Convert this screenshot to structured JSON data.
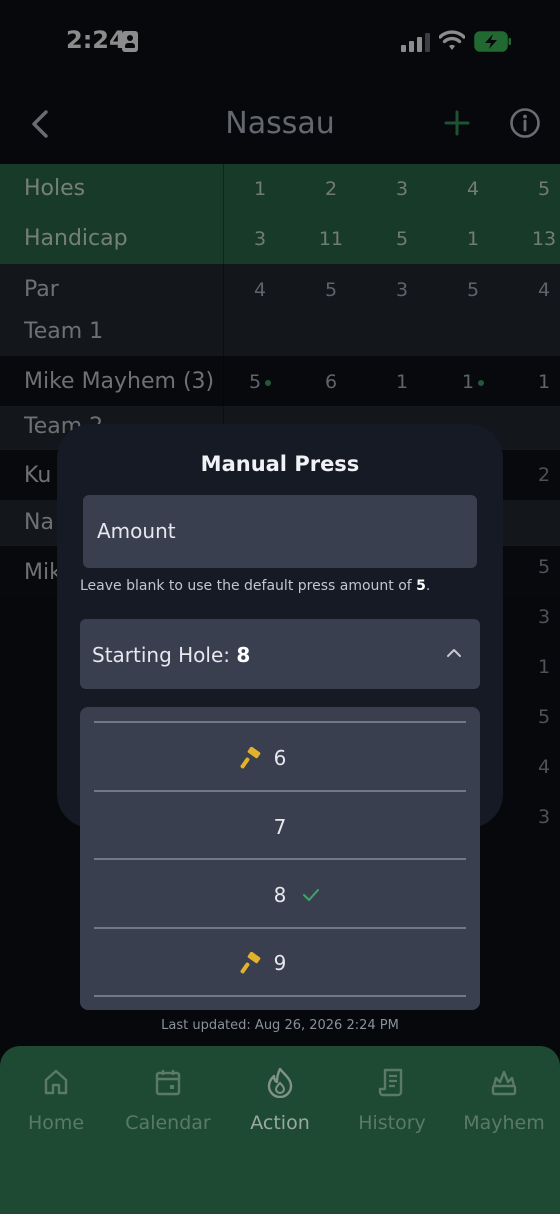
{
  "status_bar": {
    "time": "2:24"
  },
  "nav": {
    "title": "Nassau"
  },
  "table": {
    "holes_label": "Holes",
    "holes": [
      "1",
      "2",
      "3",
      "4",
      "5"
    ],
    "handicap_label": "Handicap",
    "handicap": [
      "3",
      "11",
      "5",
      "1",
      "13"
    ],
    "par_label": "Par",
    "par": [
      "4",
      "5",
      "3",
      "5",
      "4"
    ],
    "team1_label": "Team 1",
    "player1_name": "Mike Mayhem (3)",
    "player1_scores": [
      "5",
      "6",
      "1",
      "1",
      "1"
    ],
    "team2_label": "Team 2",
    "partial_row3_label": "Ku",
    "partial_row4_label": "Na",
    "partial_row5_label": "Mik",
    "right_column": [
      "2",
      "5",
      "3",
      "1",
      "5",
      "4",
      "3"
    ]
  },
  "manual_press": {
    "title": "Manual Press",
    "amount_placeholder": "Amount",
    "hint_prefix": "Leave blank to use the default press amount of ",
    "hint_amount": "5",
    "hint_suffix": ".",
    "starting_hole_label": "Starting Hole: ",
    "starting_hole_value": "8",
    "options": [
      "6",
      "7",
      "8",
      "9"
    ]
  },
  "last_updated": "Last updated: Aug 26, 2026 2:24 PM",
  "tabs": {
    "home": "Home",
    "calendar": "Calendar",
    "action": "Action",
    "history": "History",
    "mayhem": "Mayhem"
  },
  "colors": {
    "accent_green": "#2c6b49",
    "tab_bar": "#1e4a33",
    "hammer": "#e3b22c",
    "check": "#3fa36b"
  }
}
